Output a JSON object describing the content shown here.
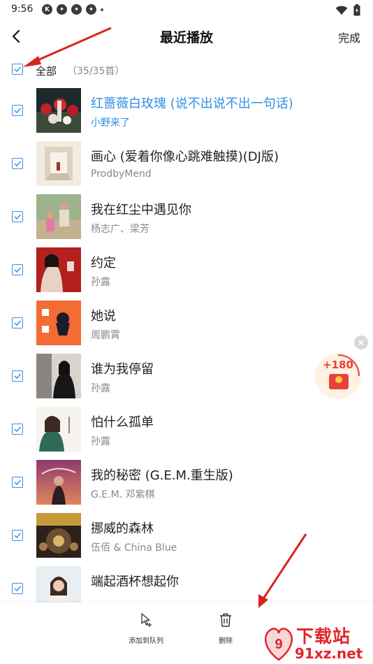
{
  "status_bar": {
    "time": "9:56",
    "icons": [
      "k-app-icon",
      "pinwheel-icon",
      "pinwheel-icon",
      "pinwheel-icon"
    ]
  },
  "header": {
    "title": "最近播放",
    "done_label": "完成"
  },
  "select_all": {
    "label": "全部",
    "count": "（35/35首）",
    "checked": true
  },
  "songs": [
    {
      "title": "红蔷薇白玫瑰 (说不出说不出一句话)",
      "artist": "小野来了",
      "active": true,
      "checked": true
    },
    {
      "title": "画心 (爱着你像心跳难触摸)(DJ版)",
      "artist": "ProdbyMend",
      "active": false,
      "checked": true
    },
    {
      "title": "我在红尘中遇见你",
      "artist": "杨志广、梁芳",
      "active": false,
      "checked": true
    },
    {
      "title": "约定",
      "artist": "孙露",
      "active": false,
      "checked": true
    },
    {
      "title": "她说",
      "artist": "周鹏霄",
      "active": false,
      "checked": true
    },
    {
      "title": "谁为我停留",
      "artist": "孙露",
      "active": false,
      "checked": true
    },
    {
      "title": "怕什么孤单",
      "artist": "孙露",
      "active": false,
      "checked": true
    },
    {
      "title": "我的秘密 (G.E.M.重生版)",
      "artist": "G.E.M. 邓紫棋",
      "active": false,
      "checked": true
    },
    {
      "title": "挪威的森林",
      "artist": "伍佰 & China Blue",
      "active": false,
      "checked": true
    },
    {
      "title": "端起酒杯想起你",
      "artist": "",
      "active": false,
      "checked": true
    }
  ],
  "reward": {
    "amount": "+180"
  },
  "toolbar": {
    "add_to_queue_label": "添加到队列",
    "delete_label": "删除"
  },
  "watermark": {
    "text_cn": "下载站",
    "url": "91xz.net"
  },
  "colors": {
    "accent": "#2f8fe3",
    "checkbox": "#3a8ee6",
    "reward_red": "#e9413a",
    "arrow_red": "#d9241f"
  }
}
